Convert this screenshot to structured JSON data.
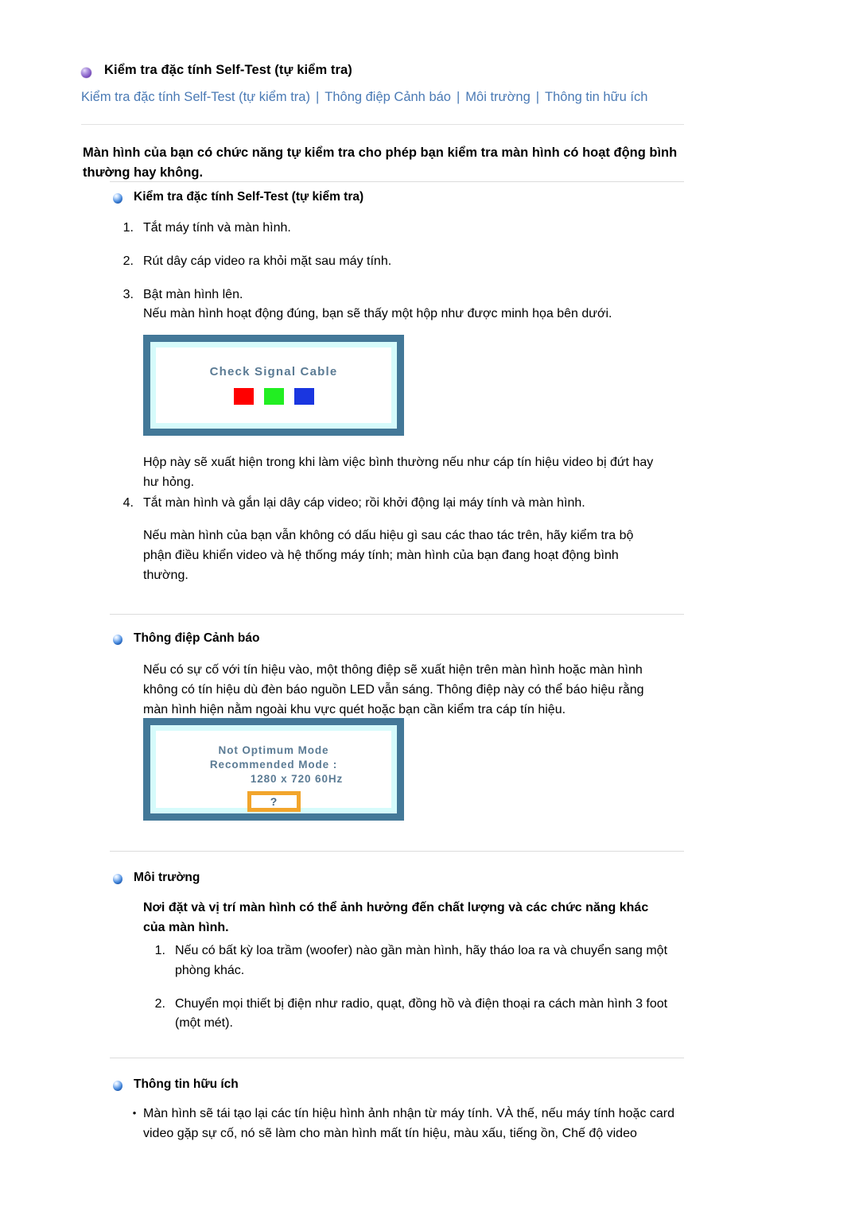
{
  "header": {
    "title": "Kiểm tra đặc tính Self-Test (tự kiểm tra)",
    "nav": [
      "Kiểm tra đặc tính Self-Test (tự kiểm tra)",
      "Thông điệp Cảnh báo",
      "Môi trường",
      "Thông tin hữu ích"
    ],
    "separator": "|",
    "link_color": "#4a7ab5"
  },
  "intro": "Màn hình của bạn có chức năng tự kiểm tra cho phép bạn kiểm tra màn hình có hoạt động bình thường hay không.",
  "sections": {
    "self_test": {
      "heading": "Kiểm tra đặc tính Self-Test (tự kiểm tra)",
      "steps": [
        {
          "num": "1.",
          "text": "Tắt máy tính và màn hình."
        },
        {
          "num": "2.",
          "text": "Rút dây cáp video ra khỏi mặt sau máy tính."
        },
        {
          "num": "3.",
          "text": "Bật màn hình lên."
        }
      ],
      "after_step3": "Nếu màn hình hoạt động đúng, bạn sẽ thấy một hộp như được minh họa bên dưới.",
      "after_image": "Hộp này sẽ xuất hiện trong khi làm việc bình thường nếu như cáp tín hiệu video bị đứt hay hư hỏng.",
      "step4": {
        "num": "4.",
        "text": "Tắt màn hình và gắn lại dây cáp video; rồi khởi động lại máy tính và màn hình."
      },
      "closing": "Nếu màn hình của bạn vẫn không có dấu hiệu gì sau các thao tác trên, hãy kiểm tra bộ phận điều khiển video và hệ thống máy tính; màn hình của bạn đang hoạt động bình thường."
    },
    "warning": {
      "heading": "Thông điệp Cảnh báo",
      "text": "Nếu có sự cố với tín hiệu vào, một thông điệp sẽ xuất hiện trên màn hình hoặc màn hình không có tín hiệu dù đèn báo nguồn LED vẫn sáng. Thông điệp này có thể báo hiệu rằng màn hình hiện nằm ngoài khu vực quét hoặc bạn cần kiểm tra cáp tín hiệu."
    },
    "environment": {
      "heading": "Môi trường",
      "lead": "Nơi đặt và vị trí màn hình có thể ảnh hưởng đến chất lượng và các chức năng khác của màn hình.",
      "steps": [
        {
          "num": "1.",
          "text": "Nếu có bất kỳ loa trầm (woofer) nào gần màn hình, hãy tháo loa ra và chuyển sang một phòng khác."
        },
        {
          "num": "2.",
          "text": "Chuyển mọi thiết bị điện như radio, quạt, đồng hồ và điện thoại ra cách màn hình 3 foot (một mét)."
        }
      ]
    },
    "useful_info": {
      "heading": "Thông tin hữu ích",
      "bullet_glyph": "•",
      "items": [
        "Màn hình sẽ tái tạo lại các tín hiệu hình ảnh nhận từ máy tính. VÀ thế, nếu máy tính hoặc card video gặp sự cố, nó sẽ làm cho màn hình mất tín hiệu, màu xấu, tiếng ồn, Chế độ video"
      ]
    }
  },
  "osd_check_signal": {
    "title": "Check Signal Cable",
    "swatches": [
      "#ff0000",
      "#22ee22",
      "#1a36e0"
    ],
    "frame_color": "#437898",
    "inner_border_color": "#d6fbfb",
    "text_color": "#5b7b94"
  },
  "osd_not_optimum": {
    "line1": "Not Optimum Mode",
    "line2": "Recommended Mode :",
    "line3": "1280 x 720   60Hz",
    "question_mark": "?",
    "question_border_color": "#f2a52c",
    "frame_color": "#437898",
    "inner_border_color": "#d6fbfb",
    "text_color": "#5b7b94"
  }
}
